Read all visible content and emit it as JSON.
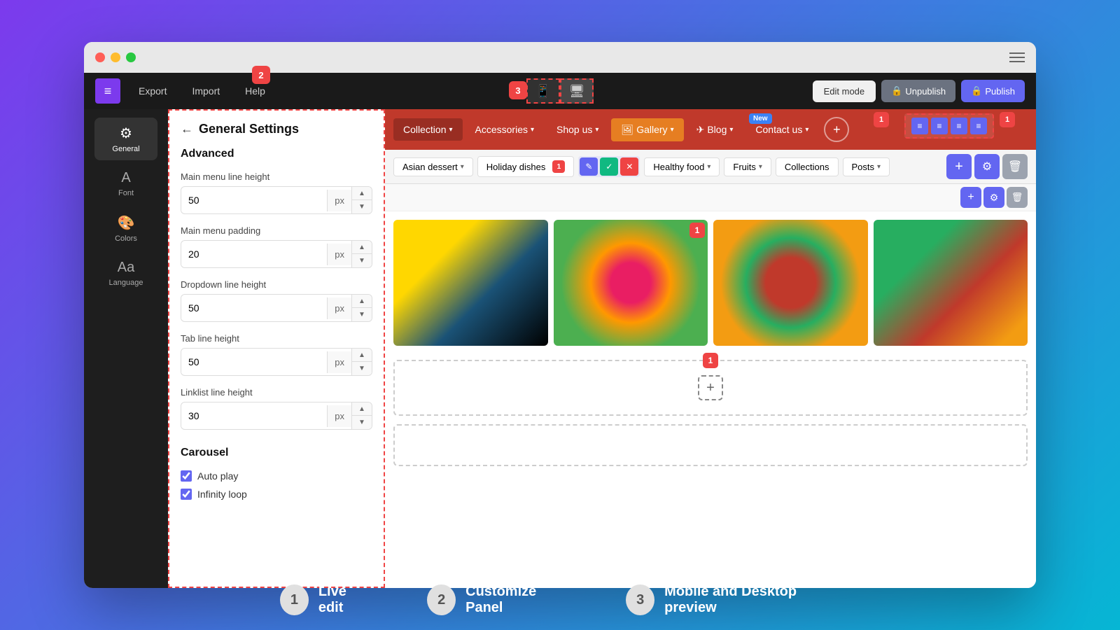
{
  "browser": {
    "traffic_lights": [
      "red",
      "yellow",
      "green"
    ]
  },
  "toolbar": {
    "export_label": "Export",
    "import_label": "Import",
    "help_label": "Help",
    "edit_mode_label": "Edit mode",
    "unpublish_label": "Unpublish",
    "publish_label": "Publish",
    "badge2": "2",
    "badge3": "3"
  },
  "sidebar": {
    "items": [
      {
        "label": "General",
        "icon": "⚙"
      },
      {
        "label": "Font",
        "icon": "A"
      },
      {
        "label": "Colors",
        "icon": "🎨"
      },
      {
        "label": "Language",
        "icon": "Aa"
      }
    ]
  },
  "panel": {
    "back_label": "←",
    "title": "General Settings",
    "section_label": "Advanced",
    "fields": [
      {
        "label": "Main menu line height",
        "value": "50",
        "unit": "px"
      },
      {
        "label": "Main menu padding",
        "value": "20",
        "unit": "px"
      },
      {
        "label": "Dropdown line height",
        "value": "50",
        "unit": "px"
      },
      {
        "label": "Tab line height",
        "value": "50",
        "unit": "px"
      },
      {
        "label": "Linklist line height",
        "value": "30",
        "unit": "px"
      }
    ],
    "carousel_title": "Carousel",
    "checkboxes": [
      {
        "label": "Auto play",
        "checked": true
      },
      {
        "label": "Infinity loop",
        "checked": true
      }
    ]
  },
  "site_nav": {
    "items": [
      {
        "label": "Collection",
        "has_chevron": true,
        "active": true
      },
      {
        "label": "Accessories",
        "has_chevron": true
      },
      {
        "label": "Shop us",
        "has_chevron": true
      },
      {
        "label": "Gallery",
        "has_chevron": true
      },
      {
        "label": "Blog",
        "has_chevron": true
      },
      {
        "label": "Contact us",
        "has_chevron": true
      }
    ],
    "new_badge": "New"
  },
  "submenu": {
    "chips": [
      {
        "label": "Asian dessert",
        "has_chevron": true
      },
      {
        "label": "Holiday dishes",
        "has_chevron": false
      },
      {
        "label": "Healthy food",
        "has_chevron": true
      },
      {
        "label": "Fruits",
        "has_chevron": true
      },
      {
        "label": "Collections",
        "has_chevron": false
      },
      {
        "label": "Posts",
        "has_chevron": true
      }
    ]
  },
  "legend": [
    {
      "num": "1",
      "text": "Live edit"
    },
    {
      "num": "2",
      "text": "Customize Panel"
    },
    {
      "num": "3",
      "text": "Mobile and Desktop preview"
    }
  ]
}
